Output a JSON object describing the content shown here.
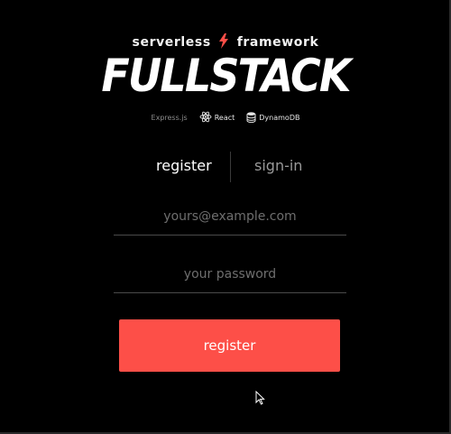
{
  "brand": {
    "left": "serverless",
    "right": "framework",
    "accent_color": "#fd4f48"
  },
  "wordmark": "FULLSTACK",
  "tech": [
    {
      "label": "Express.js",
      "icon": "none"
    },
    {
      "label": "React",
      "icon": "react-atom-icon"
    },
    {
      "label": "DynamoDB",
      "icon": "database-icon"
    }
  ],
  "tabs": {
    "register_label": "register",
    "signin_label": "sign-in",
    "active": "register"
  },
  "form": {
    "email_placeholder": "yours@example.com",
    "email_value": "",
    "password_placeholder": "your password",
    "password_value": "",
    "submit_label": "register",
    "submit_color": "#fd4f48"
  }
}
